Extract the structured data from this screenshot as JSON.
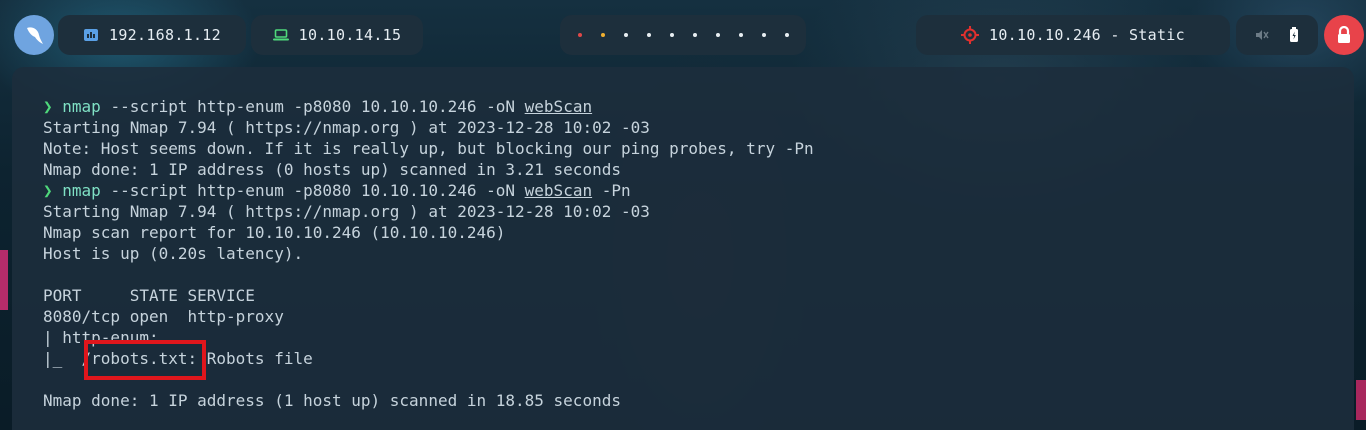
{
  "topbar": {
    "ip_local": "192.168.1.12",
    "ip_vpn": "10.10.14.15",
    "target": "10.10.10.246 - Static",
    "workspace_dot_colors": [
      "#e04848",
      "#f0b030",
      "#e8eef2",
      "#e8eef2",
      "#e8eef2",
      "#e8eef2",
      "#e8eef2",
      "#e8eef2",
      "#e8eef2",
      "#e8eef2"
    ],
    "icons": {
      "launcher": "parrot-icon",
      "local": "network-icon",
      "vpn": "laptop-icon",
      "target": "crosshair-icon",
      "mute": "muted-speaker-icon",
      "battery": "battery-icon",
      "lock": "lock-icon"
    },
    "colors": {
      "lock_button": "#e8434a",
      "target_icon": "#e0302e",
      "vpn_icon": "#4fd97b",
      "local_icon": "#5aa0e6"
    }
  },
  "terminal": {
    "prompt_symbol": "❯",
    "l1": {
      "cmd": "nmap",
      "args": " --script http-enum -p8080 10.10.10.246 -oN ",
      "file": "webScan"
    },
    "l2": "Starting Nmap 7.94 ( https://nmap.org ) at 2023-12-28 10:02 -03",
    "l3": "Note: Host seems down. If it is really up, but blocking our ping probes, try -Pn",
    "l4": "Nmap done: 1 IP address (0 hosts up) scanned in 3.21 seconds",
    "l5": {
      "cmd": "nmap",
      "args": " --script http-enum -p8080 10.10.10.246 -oN ",
      "file": "webScan",
      "tail": " -Pn"
    },
    "l6": "Starting Nmap 7.94 ( https://nmap.org ) at 2023-12-28 10:02 -03",
    "l7": "Nmap scan report for 10.10.10.246 (10.10.10.246)",
    "l8": "Host is up (0.20s latency).",
    "l9": "",
    "l10": "PORT     STATE SERVICE",
    "l11": "8080/tcp open  http-proxy",
    "l12": "| http-enum:",
    "l13": "|_  /robots.txt: Robots file",
    "l14": "",
    "l15": "Nmap done: 1 IP address (1 host up) scanned in 18.85 seconds"
  },
  "highlight_color": "#e0161c"
}
